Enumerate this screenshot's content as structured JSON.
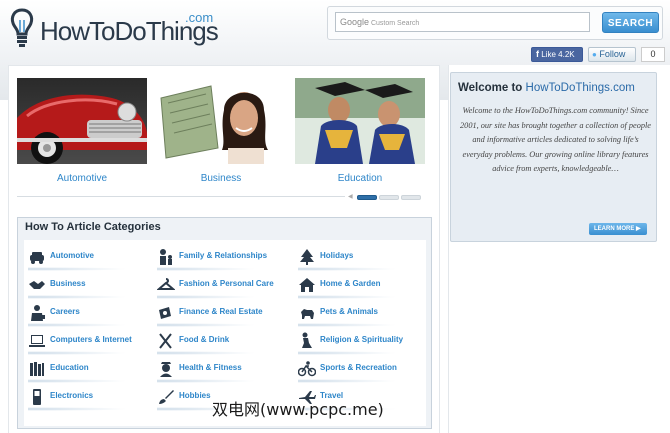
{
  "header": {
    "logo_text": "HowToDoThings",
    "logo_com": ".com",
    "search_placeholder": "Custom Search",
    "search_brand": "Google",
    "search_button": "SEARCH"
  },
  "social": {
    "like_label": "Like",
    "like_count": "4.2K",
    "follow_label": "Follow",
    "follow_count": "0"
  },
  "features": [
    {
      "label": "Automotive"
    },
    {
      "label": "Business"
    },
    {
      "label": "Education"
    }
  ],
  "categories": {
    "title": "How To Article Categories",
    "items": [
      {
        "label": "Automotive",
        "icon": "car-icon"
      },
      {
        "label": "Family & Relationships",
        "icon": "family-icon"
      },
      {
        "label": "Holidays",
        "icon": "christmas-tree-icon"
      },
      {
        "label": "Business",
        "icon": "handshake-icon"
      },
      {
        "label": "Fashion & Personal Care",
        "icon": "hanger-icon"
      },
      {
        "label": "Home & Garden",
        "icon": "house-icon"
      },
      {
        "label": "Careers",
        "icon": "worker-icon"
      },
      {
        "label": "Finance & Real Estate",
        "icon": "money-icon"
      },
      {
        "label": "Pets & Animals",
        "icon": "dog-icon"
      },
      {
        "label": "Computers & Internet",
        "icon": "laptop-icon"
      },
      {
        "label": "Food & Drink",
        "icon": "fork-knife-icon"
      },
      {
        "label": "Religion & Spirituality",
        "icon": "praying-icon"
      },
      {
        "label": "Education",
        "icon": "books-icon"
      },
      {
        "label": "Health & Fitness",
        "icon": "nurse-icon"
      },
      {
        "label": "Sports & Recreation",
        "icon": "bicycle-icon"
      },
      {
        "label": "Electronics",
        "icon": "phone-icon"
      },
      {
        "label": "Hobbies",
        "icon": "paintbrush-icon"
      },
      {
        "label": "Travel",
        "icon": "airplane-icon"
      }
    ]
  },
  "welcome": {
    "title_prefix": "Welcome to ",
    "title_site": "HowToDoThings.com",
    "text": "Welcome to the HowToDoThings.com community! Since 2001, our site has brought together a collection of people and informative articles dedicated to solving life’s everyday problems. Our growing online library features advice from experts, knowledgeable…",
    "button": "LEARN MORE"
  },
  "watermark": "双电网(www.pcpc.me)"
}
